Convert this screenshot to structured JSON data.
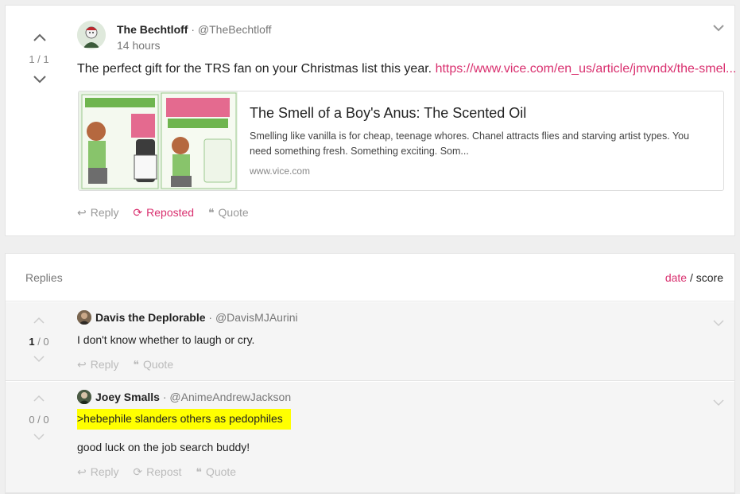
{
  "post": {
    "vote_count": "1 / 1",
    "author_name": "The Bechtloff",
    "author_handle": "@TheBechtloff",
    "time": "14 hours",
    "text": "The perfect gift for the TRS fan on your Christmas list this year. ",
    "link": "https://www.vice.com/en_us/article/jmvndx/the-smel...",
    "preview": {
      "title": "The Smell of a Boy's Anus: The Scented Oil",
      "description": "Smelling like vanilla is for cheap, teenage whores. Chanel attracts flies and starving artist types. You need something fresh. Something exciting. Som...",
      "domain": "www.vice.com"
    },
    "actions": {
      "reply": "Reply",
      "repost": "Reposted",
      "quote": "Quote"
    }
  },
  "replies_section": {
    "title": "Replies",
    "sort_date": "date",
    "sort_sep": " / ",
    "sort_score": "score"
  },
  "replies": [
    {
      "vote_up": "1",
      "vote_rest": " / 0",
      "author_name": "Davis the Deplorable",
      "author_handle": "@DavisMJAurini",
      "text": "I don't know whether to laugh or cry.",
      "actions": {
        "reply": "Reply",
        "quote": "Quote"
      }
    },
    {
      "vote_count": "0 / 0",
      "author_name": "Joey Smalls",
      "author_handle": "@AnimeAndrewJackson",
      "text_highlight": ">hebephile slanders others as pedophiles",
      "text": "good luck on the job search buddy!",
      "actions": {
        "reply": "Reply",
        "repost": "Repost",
        "quote": "Quote"
      }
    }
  ],
  "colors": {
    "accent": "#d9306f",
    "highlight": "#ffff00",
    "background": "#efefef"
  }
}
